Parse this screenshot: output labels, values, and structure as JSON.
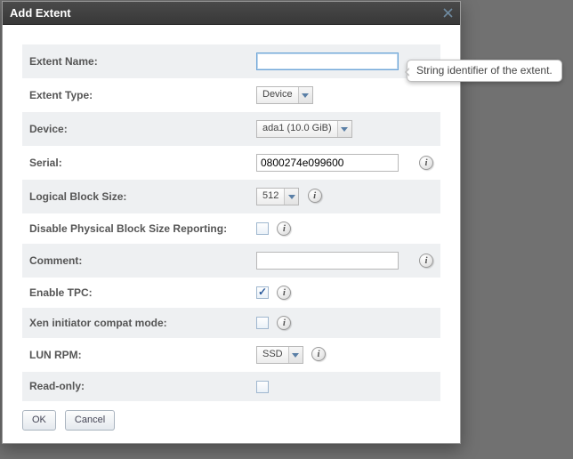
{
  "dialog": {
    "title": "Add Extent",
    "close_icon": "close"
  },
  "fields": {
    "extent_name": {
      "label": "Extent Name:",
      "value": ""
    },
    "extent_type": {
      "label": "Extent Type:",
      "selected": "Device"
    },
    "device": {
      "label": "Device:",
      "selected": "ada1 (10.0 GiB)"
    },
    "serial": {
      "label": "Serial:",
      "value": "0800274e099600"
    },
    "logical_block_size": {
      "label": "Logical Block Size:",
      "selected": "512"
    },
    "disable_pbs_reporting": {
      "label": "Disable Physical Block Size Reporting:",
      "checked": false
    },
    "comment": {
      "label": "Comment:",
      "value": ""
    },
    "enable_tpc": {
      "label": "Enable TPC:",
      "checked": true
    },
    "xen_compat": {
      "label": "Xen initiator compat mode:",
      "checked": false
    },
    "lun_rpm": {
      "label": "LUN RPM:",
      "selected": "SSD"
    },
    "read_only": {
      "label": "Read-only:",
      "checked": false
    }
  },
  "buttons": {
    "ok": "OK",
    "cancel": "Cancel"
  },
  "tooltip": {
    "extent_name": "String identifier of the extent."
  }
}
